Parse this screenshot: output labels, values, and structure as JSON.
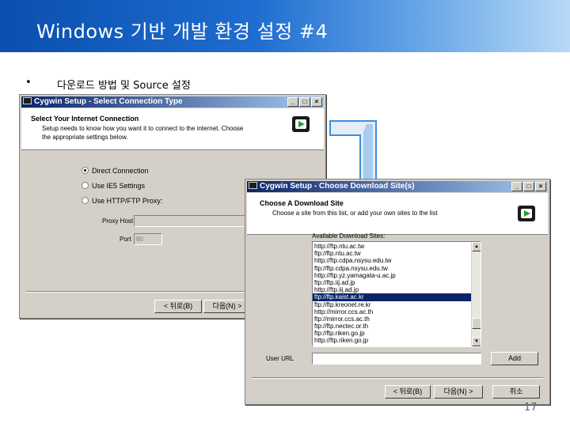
{
  "slide": {
    "title": "Windows 기반 개발 환경 설정 #4",
    "bullet_marker": "•",
    "bullet_text": "다운로드 방법 및 Source 설정",
    "page_number": "17"
  },
  "window1": {
    "title": "Cygwin Setup - Select Connection Type",
    "header_title": "Select Your Internet Connection",
    "header_desc_line1": "Setup needs to know how you want it to connect to the internet. Choose",
    "header_desc_line2": "the appropriate settings below.",
    "options": [
      {
        "label": "Direct Connection",
        "selected": true
      },
      {
        "label": "Use IE5 Settings",
        "selected": false
      },
      {
        "label": "Use HTTP/FTP Proxy:",
        "selected": false
      }
    ],
    "proxy_host_label": "Proxy Host",
    "port_label": "Port",
    "port_value": "80",
    "back_button": "< 뒤로(B)",
    "next_button": "다음(N) >"
  },
  "window2": {
    "title": "Cygwin Setup - Choose Download Site(s)",
    "header_title": "Choose A Download Site",
    "header_desc": "Choose a site from this list, or add your own sites to the list",
    "available_label": "Available Download Sites:",
    "sites": [
      "http://ftp.ntu.ac.tw",
      "ftp://ftp.ntu.ac.tw",
      "http://ftp.cdpa.nsysu.edu.tw",
      "ftp://ftp.cdpa.nsysu.edu.tw",
      "http://ftp.yz.yamagata-u.ac.jp",
      "ftp://ftp.iij.ad.jp",
      "http://ftp.iij.ad.jp",
      "ftp://ftp.kaist.ac.kr",
      "ftp://ftp.kreonet.re.kr",
      "http://mirror.ccs.ac.th",
      "ftp://mirror.ccs.ac.th",
      "ftp://ftp.nectec.or.th",
      "ftp://ftp.riken.go.jp",
      "http://ftp.riken.go.jp"
    ],
    "selected_index": 7,
    "user_url_label": "User URL",
    "add_button": "Add",
    "back_button": "< 뒤로(B)",
    "next_button": "다음(N) >",
    "cancel_button": "취소"
  },
  "colors": {
    "title_bar_start": "#0a4fae",
    "title_bar_end": "#b9d9f6",
    "dialog_face": "#d4d0c8",
    "selection": "#0a246a",
    "arrow": "#3b8fe0"
  },
  "icons": {
    "minimize": "_",
    "maximize": "□",
    "close": "×",
    "scroll_up": "▲",
    "scroll_down": "▼"
  }
}
